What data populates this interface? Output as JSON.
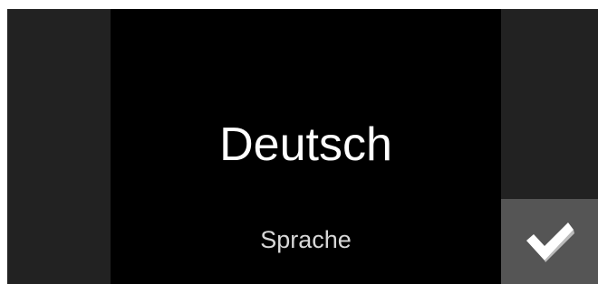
{
  "setting": {
    "value": "Deutsch",
    "label": "Sprache"
  },
  "confirm": {
    "icon": "checkmark-icon"
  },
  "colors": {
    "background": "#000000",
    "side_panel": "#222222",
    "confirm_button": "#555555",
    "value_text": "#ffffff",
    "label_text": "#d8d8d8"
  }
}
